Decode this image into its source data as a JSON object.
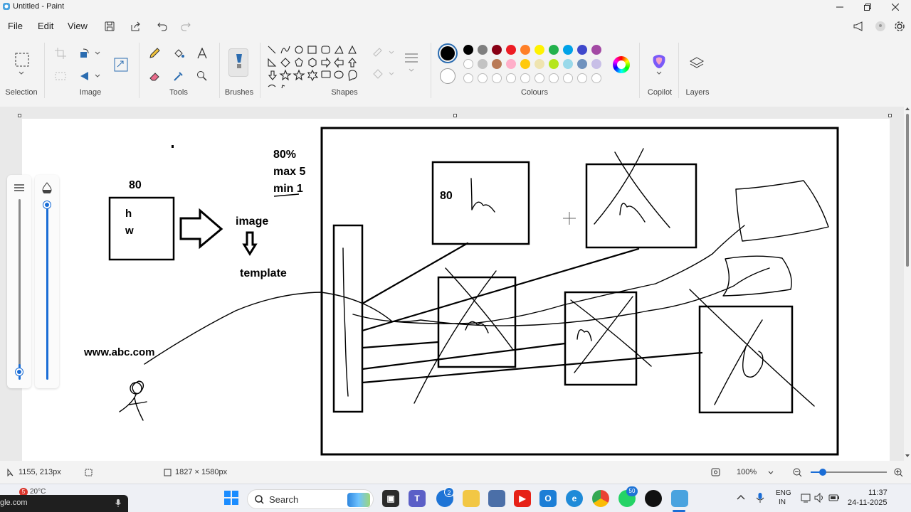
{
  "window": {
    "title": "Untitled - Paint"
  },
  "menu": {
    "file": "File",
    "edit": "Edit",
    "view": "View"
  },
  "ribbon": {
    "groups": {
      "selection": "Selection",
      "image": "Image",
      "tools": "Tools",
      "brushes": "Brushes",
      "shapes": "Shapes",
      "colours": "Colours",
      "copilot": "Copilot",
      "layers": "Layers"
    },
    "primary_color": "#000000",
    "secondary_color": "#ffffff",
    "palette_row1": [
      "#000000",
      "#7f7f7f",
      "#880015",
      "#ed1c24",
      "#ff7f27",
      "#fff200",
      "#22b14c",
      "#00a2e8",
      "#3f48cc",
      "#a349a4"
    ],
    "palette_row2": [
      "#ffffff",
      "#c3c3c3",
      "#b97a57",
      "#ffaec9",
      "#ffc90e",
      "#efe4b0",
      "#b5e61d",
      "#99d9ea",
      "#7092be",
      "#c8bfe7"
    ]
  },
  "canvas_text": {
    "label_80_top": "80",
    "label_h": "h",
    "label_w": "w",
    "pct": "80%",
    "max": "max 5",
    "min": "min 1",
    "image": "image",
    "template": "template",
    "url": "www.abc.com",
    "box_80": "80"
  },
  "status": {
    "cursor_pos": "1155, 213px",
    "canvas_size": "1827 × 1580px",
    "zoom": "100%"
  },
  "taskbar": {
    "search_placeholder": "Search",
    "weather_temp": "20°C",
    "weather_badge": "5",
    "teams_badge": "2",
    "whatsapp_badge": "50",
    "lang_top": "ENG",
    "lang_bottom": "IN",
    "time": "11:37",
    "date": "24-11-2025",
    "popup_text": "gle.com"
  }
}
